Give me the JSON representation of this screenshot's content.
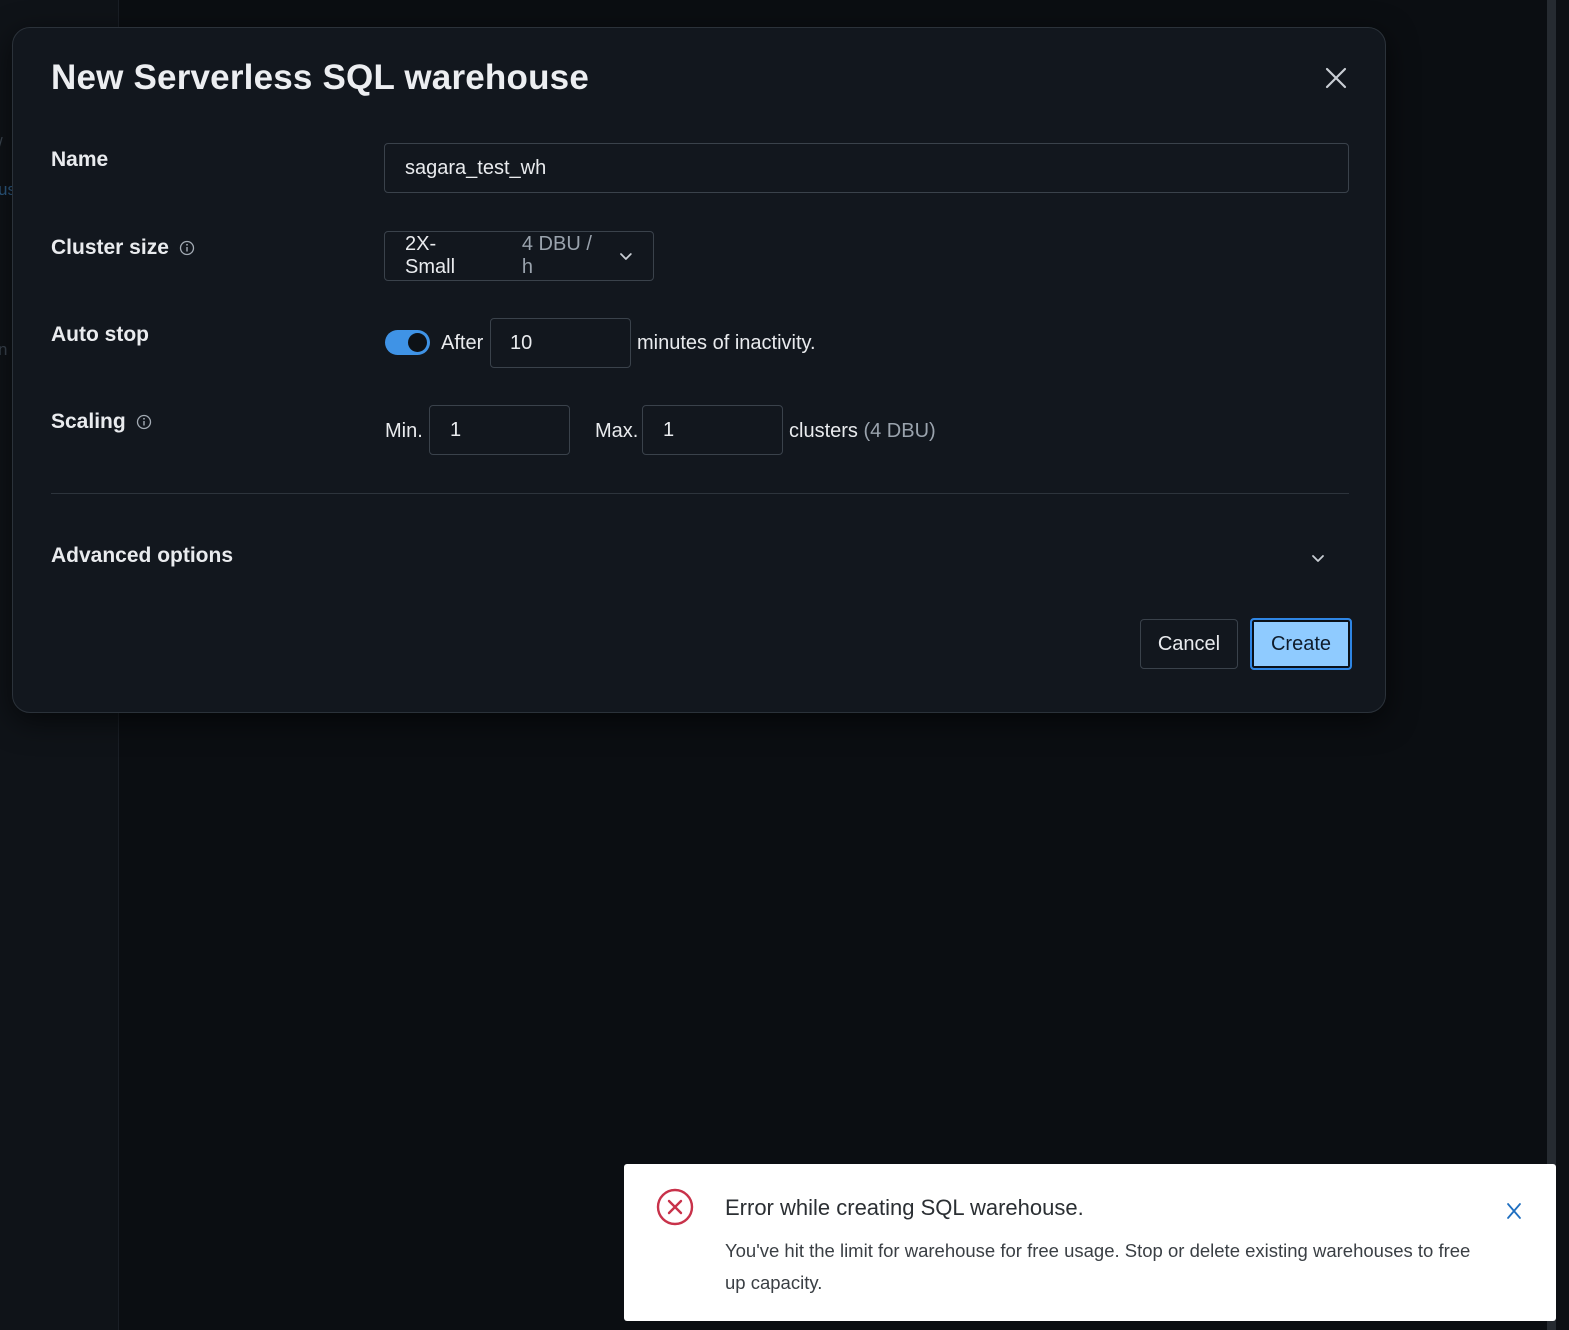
{
  "modal": {
    "title": "New Serverless SQL warehouse",
    "close_icon": "close-icon"
  },
  "form": {
    "name_label": "Name",
    "name_value": "sagara_test_wh",
    "cluster_size_label": "Cluster size",
    "cluster_size_value": "2X-Small",
    "cluster_size_rate": "4 DBU / h",
    "auto_stop_label": "Auto stop",
    "auto_stop_enabled": true,
    "auto_stop_prefix": "After",
    "auto_stop_minutes": "10",
    "auto_stop_suffix": "minutes of inactivity.",
    "scaling_label": "Scaling",
    "min_label": "Min.",
    "min_value": "1",
    "max_label": "Max.",
    "max_value": "1",
    "clusters_text": "clusters",
    "clusters_dbu": "(4 DBU)",
    "advanced_label": "Advanced options"
  },
  "actions": {
    "cancel_label": "Cancel",
    "create_label": "Create"
  },
  "toast": {
    "title": "Error while creating SQL warehouse.",
    "body": "You've hit the limit for warehouse for free usage. Stop or delete existing warehouses to free up capacity.",
    "icon": "error-circle-icon",
    "close_label": "X"
  },
  "colors": {
    "accent": "#3f93e6",
    "create_button": "#8fcbff",
    "error": "#c8324a",
    "modal_bg": "#12171e"
  }
}
